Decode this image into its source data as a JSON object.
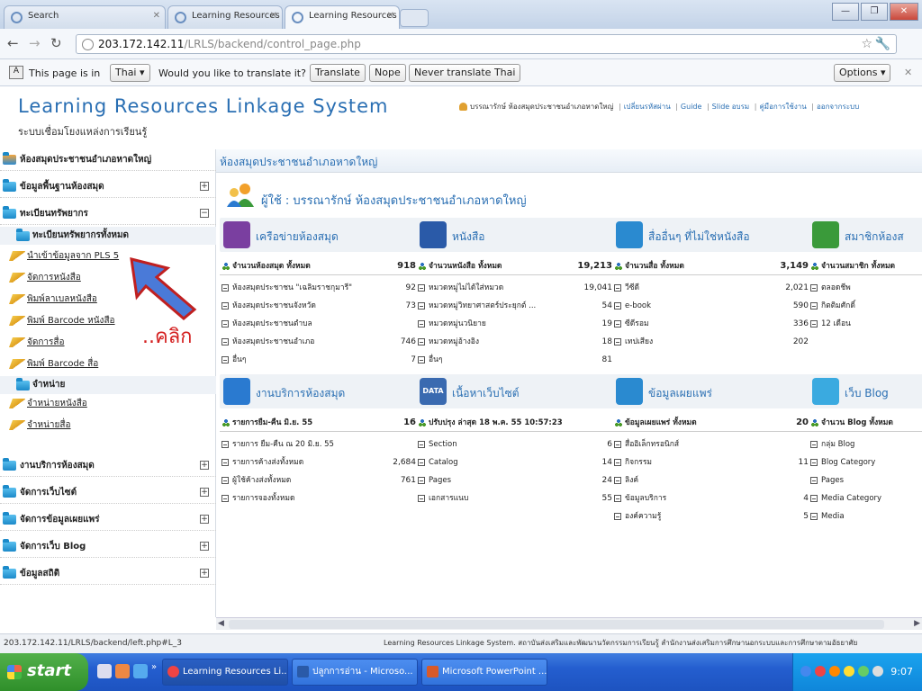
{
  "browser": {
    "tabs": [
      {
        "label": "Search",
        "active": false
      },
      {
        "label": "Learning Resources Linkage Sy",
        "active": false
      },
      {
        "label": "Learning Resources Linkage Sy",
        "active": true
      }
    ],
    "url_host": "203.172.142.11",
    "url_path": "/LRLS/backend/control_page.php",
    "window_buttons": {
      "minimize": "—",
      "maximize": "❐",
      "close": "✕"
    }
  },
  "translate_bar": {
    "prefix": "This page is in",
    "language": "Thai",
    "question": "Would you like to translate it?",
    "translate_label": "Translate",
    "nope_label": "Nope",
    "never_label": "Never translate Thai",
    "options_label": "Options"
  },
  "header": {
    "logo_en": "Learning Resources Linkage System",
    "logo_th": "ระบบเชื่อมโยงแหล่งการเรียนรู้",
    "user_label": "บรรณารักษ์ ห้องสมุดประชาชนอำเภอหาดใหญ่",
    "links": [
      "เปลี่ยนรหัสผ่าน",
      "Guide",
      "Slide อบรม",
      "คู่มือการใช้งาน",
      "ออกจากระบบ"
    ]
  },
  "sidebar": {
    "top": "ห้องสมุดประชาชนอำเภอหาดใหญ่",
    "library_info": "ข้อมูลพื้นฐานห้องสมุด",
    "resources": "ทะเบียนทรัพยากร",
    "all_resources": "ทะเบียนทรัพยากรทั้งหมด",
    "leaves": [
      "นำเข้าข้อมูลจาก PLS 5",
      "จัดการหนังสือ",
      "พิมพ์ลาเบลหนังสือ",
      "พิมพ์ Barcode หนังสือ",
      "จัดการสื่อ",
      "พิมพ์ Barcode สื่อ"
    ],
    "distribution": "จำหน่าย",
    "dist_leaves": [
      "จำหน่ายหนังสือ",
      "จำหน่ายสื่อ"
    ],
    "groups": [
      "งานบริการห้องสมุด",
      "จัดการเว็บไซต์",
      "จัดการข้อมูลเผยแพร่",
      "จัดการเว็บ Blog",
      "ข้อมูลสถิติ"
    ]
  },
  "annotation": {
    "click_label": "..คลิก"
  },
  "main": {
    "title": "ห้องสมุดประชาชนอำเภอหาดใหญ่",
    "user_line": "ผู้ใช้ : บรรณารักษ์ ห้องสมุดประชาชนอำเภอหาดใหญ่",
    "panels": [
      {
        "title": "เครือข่ายห้องสมุด",
        "color": "#7a3fa0",
        "rows": [
          [
            "จำนวนห้องสมุด ทั้งหมด",
            "918"
          ],
          [
            "ห้องสมุดประชาชน \"เฉลิมราชกุมารี\"",
            "92"
          ],
          [
            "ห้องสมุดประชาชนจังหวัด",
            "73"
          ],
          [
            "ห้องสมุดประชาชนตำบล",
            ""
          ],
          [
            "ห้องสมุดประชาชนอำเภอ",
            "746"
          ],
          [
            "อื่นๆ",
            "7"
          ]
        ]
      },
      {
        "title": "หนังสือ",
        "color": "#2a5aa8",
        "rows": [
          [
            "จำนวนหนังสือ ทั้งหมด",
            "19,213"
          ],
          [
            "หมวดหมู่ไม่ได้ใส่หมวด",
            "19,041"
          ],
          [
            "หมวดหมู่วิทยาศาสตร์ประยุกต์ ...",
            "54"
          ],
          [
            "หมวดหมู่นวนิยาย",
            "19"
          ],
          [
            "หมวดหมู่อ้างอิง",
            "18"
          ],
          [
            "อื่นๆ",
            "81"
          ]
        ]
      },
      {
        "title": "สื่ออื่นๆ ที่ไม่ใช่หนังสือ",
        "color": "#2a8ad0",
        "rows": [
          [
            "จำนวนสื่อ ทั้งหมด",
            "3,149"
          ],
          [
            "วีซีดี",
            "2,021"
          ],
          [
            "e-book",
            "590"
          ],
          [
            "ซีดีรอม",
            "336"
          ],
          [
            "เทปเสียง",
            "202"
          ]
        ]
      },
      {
        "title": "สมาชิกห้องส",
        "color": "#3a9a3a",
        "rows": [
          [
            "จำนวนสมาชิก ทั้งหมด",
            ""
          ],
          [
            "ตลอดชีพ",
            ""
          ],
          [
            "กิตติมศักดิ์",
            ""
          ],
          [
            "12 เดือน",
            ""
          ]
        ]
      },
      {
        "title": "งานบริการห้องสมุด",
        "color": "#2a7ad0",
        "rows": [
          [
            "รายการยืม-คืน มิ.ย. 55",
            "16"
          ],
          [
            "รายการ ยืม-คืน ณ 20 มิ.ย. 55",
            ""
          ],
          [
            "รายการค้างส่งทั้งหมด",
            "2,684"
          ],
          [
            "ผู้ใช้ค้างส่งทั้งหมด",
            "761"
          ],
          [
            "รายการจองทั้งหมด",
            ""
          ]
        ]
      },
      {
        "title": "เนื้อหาเว็บไซต์",
        "color": "#3a6ab0",
        "icon_text": "DATA",
        "rows": [
          [
            "ปรับปรุง ล่าสุด 18 พ.ค. 55 10:57:23",
            ""
          ],
          [
            "Section",
            "6"
          ],
          [
            "Catalog",
            "14"
          ],
          [
            "Pages",
            "24"
          ],
          [
            "เอกสารแนบ",
            "55"
          ]
        ]
      },
      {
        "title": "ข้อมูลเผยแพร่",
        "color": "#2a8ad0",
        "rows": [
          [
            "ข้อมูลเผยแพร่ ทั้งหมด",
            "20"
          ],
          [
            "สื่ออิเล็กทรอนิกส์",
            ""
          ],
          [
            "กิจกรรม",
            "11"
          ],
          [
            "ลิงค์",
            ""
          ],
          [
            "ข้อมูลบริการ",
            "4"
          ],
          [
            "องค์ความรู้",
            "5"
          ]
        ]
      },
      {
        "title": "เว็บ Blog",
        "color": "#3aaae0",
        "rows": [
          [
            "จำนวน Blog ทั้งหมด",
            ""
          ],
          [
            "กลุ่ม Blog",
            ""
          ],
          [
            "Blog Category",
            ""
          ],
          [
            "Pages",
            ""
          ],
          [
            "Media Category",
            ""
          ],
          [
            "Media",
            ""
          ]
        ]
      }
    ]
  },
  "status": {
    "url": "203.172.142.11/LRLS/backend/left.php#L_3",
    "footer": "Learning Resources Linkage System. สถาบันส่งเสริมและพัฒนานวัตกรรมการเรียนรู้ สำนักงานส่งเสริมการศึกษานอกระบบและการศึกษาตามอัธยาศัย"
  },
  "taskbar": {
    "start_label": "start",
    "tasks": [
      "Learning Resources Li...",
      "ปลูกการอ่าน - Microso...",
      "Microsoft PowerPoint ..."
    ],
    "clock": "9:07"
  }
}
